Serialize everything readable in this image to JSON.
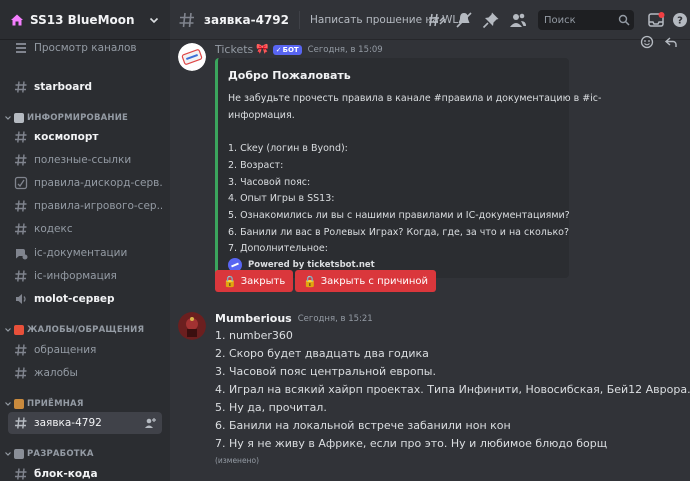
{
  "server": {
    "name": "SS13 BlueMoon"
  },
  "sidebar": {
    "browse_label": "Просмотр каналов",
    "channels": [
      {
        "label": "starboard"
      },
      {
        "label": "космопорт"
      },
      {
        "label": "полезные-ссылки"
      },
      {
        "label": "правила-дискорд-серв..."
      },
      {
        "label": "правила-игрового-сер..."
      },
      {
        "label": "кодекс"
      },
      {
        "label": "ic-документации"
      },
      {
        "label": "ic-информация"
      },
      {
        "label": "molot-сервер"
      },
      {
        "label": "обращения"
      },
      {
        "label": "жалобы"
      },
      {
        "label": "заявка-4792"
      },
      {
        "label": "блок-кода"
      }
    ],
    "categories": [
      {
        "label": "ИНФОРМИРОВАНИЕ"
      },
      {
        "label": "ЖАЛОБЫ/ОБРАЩЕНИЯ"
      },
      {
        "label": "ПРИЁМНАЯ"
      },
      {
        "label": "РАЗРАБОТКА"
      }
    ]
  },
  "topbar": {
    "channel_name": "заявка-4792",
    "topic": "Написать прошение на WL",
    "search_placeholder": "Поиск"
  },
  "messages": [
    {
      "author": "Tickets",
      "badge": "БОТ",
      "timestamp": "Сегодня, в 15:09",
      "embed": {
        "title": "Добро Пожаловать",
        "lines": [
          "Не забудьте прочесть правила в канале #правила и документацию в #ic-",
          "информация.",
          "",
          "1. Ckey (логин в Byond):",
          "2. Возраст:",
          "3. Часовой пояс:",
          "4. Опыт Игры в SS13:",
          "5. Ознакомились ли вы с нашими правилами и IC-документациями?",
          "6. Банили ли вас в Ролевых Играх? Когда, где, за что и на сколько?",
          "7. Дополнительное:"
        ],
        "footer": "Powered by ticketsbot.net",
        "accent_color": "#3ba55d"
      },
      "buttons": [
        {
          "label": "Закрыть"
        },
        {
          "label": "Закрыть с причиной"
        }
      ]
    },
    {
      "author": "Mumberious",
      "timestamp": "Сегодня, в 15:21",
      "lines": [
        "1. number360",
        "2. Скоро будет двадцать два годика",
        "3. Часовой пояс центральной европы.",
        "4. Играл на всякий хайрп проектах. Типа Инфинити, Новосибская, Бей12 Аврора.",
        "5. Ну да, прочитал.",
        "6. Банили на локальной встрече забанили нон кон",
        "7. Ну я не живу в Африке, если про это. Ну и любимое блюдо борщ"
      ],
      "edited": "(изменено)"
    }
  ],
  "colors": {
    "danger": "#da373c",
    "blurple": "#5865f2",
    "background": "#313338",
    "sidebar": "#2b2d31"
  },
  "icons": [
    "home-icon",
    "chevron-down-icon",
    "list-icon",
    "hash-icon",
    "speaker-icon",
    "threads-icon",
    "mute-icon",
    "pin-icon",
    "members-icon",
    "search-icon",
    "inbox-icon",
    "reaction-icon",
    "reply-icon",
    "lock-icon"
  ]
}
